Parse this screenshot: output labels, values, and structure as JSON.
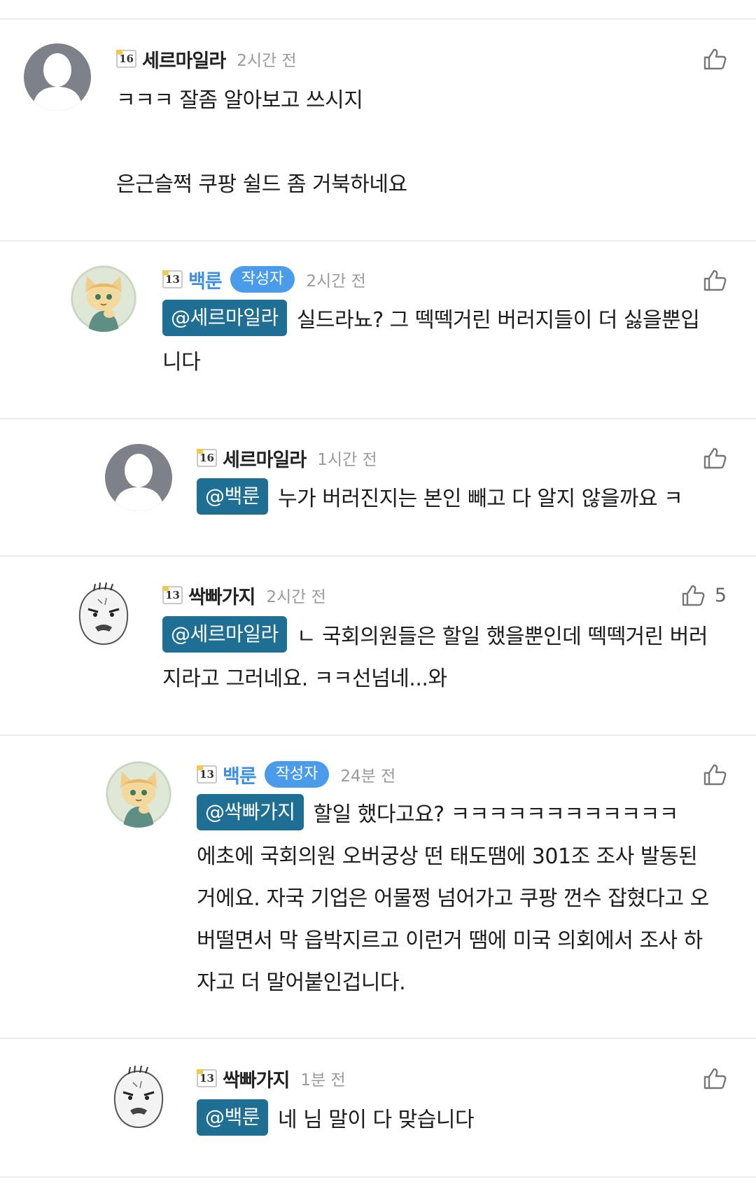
{
  "comments": [
    {
      "level": "16",
      "nickname": "세르마일라",
      "is_author": false,
      "author_badge": "",
      "time": "2시간 전",
      "likes": "",
      "mention": "",
      "lines": [
        "ㅋㅋㅋ 잘좀 알아보고 쓰시지",
        "은근슬쩍 쿠팡 쉴드 좀 거북하네요"
      ],
      "avatar": "default-person-avatar"
    },
    {
      "level": "13",
      "nickname": "백룬",
      "is_author": true,
      "author_badge": "작성자",
      "time": "2시간 전",
      "likes": "",
      "mention": "@세르마일라",
      "lines": [
        "실드라뇨? 그 떽떽거린 버러지들이 더 싫을뿐입",
        "니다"
      ],
      "avatar": "cat-character-avatar"
    },
    {
      "level": "16",
      "nickname": "세르마일라",
      "is_author": false,
      "author_badge": "",
      "time": "1시간 전",
      "likes": "",
      "mention": "@백룬",
      "lines": [
        "누가 버러진지는 본인 빼고 다 알지 않을까요 ㅋ"
      ],
      "avatar": "default-person-avatar"
    },
    {
      "level": "13",
      "nickname": "싹빠가지",
      "is_author": false,
      "author_badge": "",
      "time": "2시간 전",
      "likes": "5",
      "mention": "@세르마일라",
      "lines": [
        "ㄴ 국회의원들은 할일 했을뿐인데 떽떽거린 버러",
        "지라고 그러네요. ㅋㅋ선넘네...와"
      ],
      "avatar": "white-bear-avatar"
    },
    {
      "level": "13",
      "nickname": "백룬",
      "is_author": true,
      "author_badge": "작성자",
      "time": "24분 전",
      "likes": "",
      "mention": "@싹빠가지",
      "lines": [
        "할일 했다고요? ㅋㅋㅋㅋㅋㅋㅋㅋㅋㅋㅋㅋ",
        "에초에 국회의원 오버궁상 떤 태도땜에 301조 조사 발동된",
        "거에요. 자국 기업은 어물쩡 넘어가고 쿠팡 껀수 잡혔다고 오",
        "버떨면서 막 읍박지르고 이런거 땜에 미국 의회에서 조사 하",
        "자고 더 말어붙인겁니다."
      ],
      "avatar": "cat-character-avatar"
    },
    {
      "level": "13",
      "nickname": "싹빠가지",
      "is_author": false,
      "author_badge": "",
      "time": "1분 전",
      "likes": "",
      "mention": "@백룬",
      "lines": [
        "네 님 말이 다 맞습니다"
      ],
      "avatar": "white-bear-avatar"
    }
  ],
  "colors": {
    "author_badge": "#4a9bea",
    "mention_bg": "#1f6e94",
    "author_nick": "#3d8fe0",
    "time": "#9a9a9a"
  },
  "icons": {
    "like": "thumbs-up-icon"
  }
}
